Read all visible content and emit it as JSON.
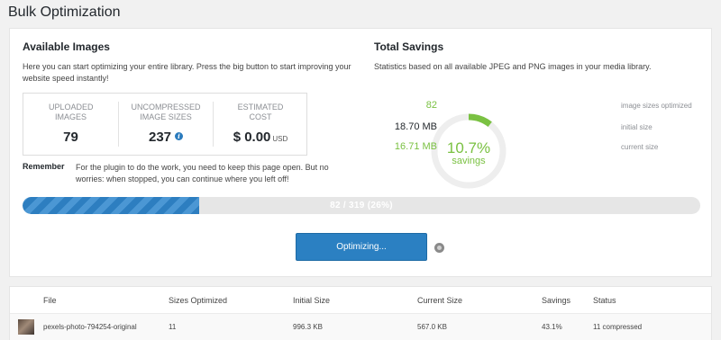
{
  "page": {
    "title": "Bulk Optimization"
  },
  "available": {
    "heading": "Available Images",
    "description": "Here you can start optimizing your entire library. Press the big button to start improving your website speed instantly!",
    "stats": {
      "uploaded": {
        "label": "Uploaded Images",
        "value": "79"
      },
      "uncompressed": {
        "label": "Uncompressed Image Sizes",
        "value": "237"
      },
      "cost": {
        "label": "Estimated Cost",
        "value": "$ 0.00",
        "unit": "USD"
      }
    },
    "remember_label": "Remember",
    "remember_text": "For the plugin to do the work, you need to keep this page open. But no worries: when stopped, you can continue where you left off!"
  },
  "progress": {
    "text": "82 / 319 (26%)",
    "fraction": 0.26,
    "color": "#2d7ec0"
  },
  "optimize_button": {
    "label": "Optimizing..."
  },
  "savings": {
    "heading": "Total Savings",
    "description": "Statistics based on all available JPEG and PNG images in your media library.",
    "percent": "10.7%",
    "percent_value": 10.7,
    "percent_label": "savings",
    "accent_color": "#7ac142",
    "rows": [
      {
        "value": "82",
        "label": "image sizes optimized",
        "color": "#7ac142"
      },
      {
        "value": "18.70 MB",
        "label": "initial size",
        "color": "#23282d"
      },
      {
        "value": "16.71 MB",
        "label": "current size",
        "color": "#7ac142"
      }
    ]
  },
  "table": {
    "headers": [
      "File",
      "Sizes Optimized",
      "Initial Size",
      "Current Size",
      "Savings",
      "Status"
    ],
    "rows": [
      {
        "file": "pexels-photo-794254-original",
        "sizes": "11",
        "initial": "996.3 KB",
        "current": "567.0 KB",
        "savings": "43.1%",
        "status": "11 compressed"
      }
    ]
  }
}
